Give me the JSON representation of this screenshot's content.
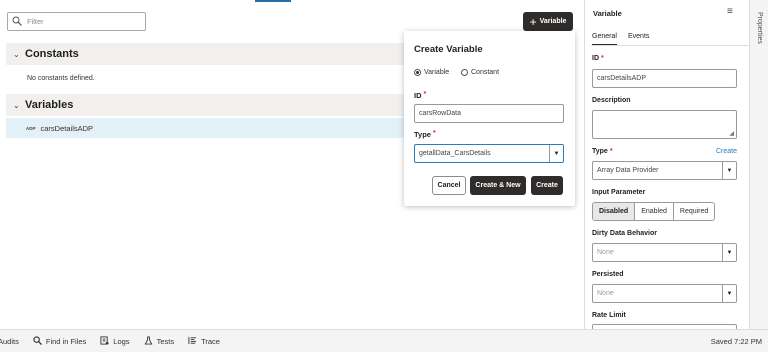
{
  "filter": {
    "placeholder": "Filter",
    "icon": "search-icon"
  },
  "add_variable_button": {
    "label": "Variable",
    "icon": "plus-icon"
  },
  "constants": {
    "title": "Constants",
    "empty_text": "No constants defined."
  },
  "variables": {
    "title": "Variables",
    "items": [
      {
        "badge": "ADP",
        "name": "carsDetailsADP"
      }
    ]
  },
  "dialog": {
    "title": "Create Variable",
    "radio_variable": "Variable",
    "radio_constant": "Constant",
    "selected": "Variable",
    "id_label": "ID",
    "id_value": "carsRowData",
    "type_label": "Type",
    "type_value": "getallData_CarsDetails",
    "cancel_label": "Cancel",
    "create_new_label": "Create & New",
    "create_label": "Create",
    "required_mark": "*"
  },
  "properties": {
    "title": "Variable",
    "tabs": [
      "General",
      "Events"
    ],
    "active_tab": "General",
    "id_label": "ID",
    "id_value": "carsDetailsADP",
    "description_label": "Description",
    "type_label": "Type",
    "type_create": "Create",
    "type_value": "Array Data Provider",
    "input_param_label": "Input Parameter",
    "input_param_options": [
      "Disabled",
      "Enabled",
      "Required"
    ],
    "input_param_selected": "Disabled",
    "dirty_label": "Dirty Data Behavior",
    "dirty_value": "None",
    "persisted_label": "Persisted",
    "persisted_value": "None",
    "rate_limit_label": "Rate Limit",
    "required_mark": "*"
  },
  "side_tab": {
    "label": "Properties"
  },
  "statusbar": {
    "items": [
      {
        "label": "Audits",
        "icon": "audits-icon"
      },
      {
        "label": "Find in Files",
        "icon": "search-icon"
      },
      {
        "label": "Logs",
        "icon": "logs-icon"
      },
      {
        "label": "Tests",
        "icon": "tests-flask-icon"
      },
      {
        "label": "Trace",
        "icon": "trace-icon"
      }
    ],
    "saved_text": "Saved 7:22 PM"
  }
}
